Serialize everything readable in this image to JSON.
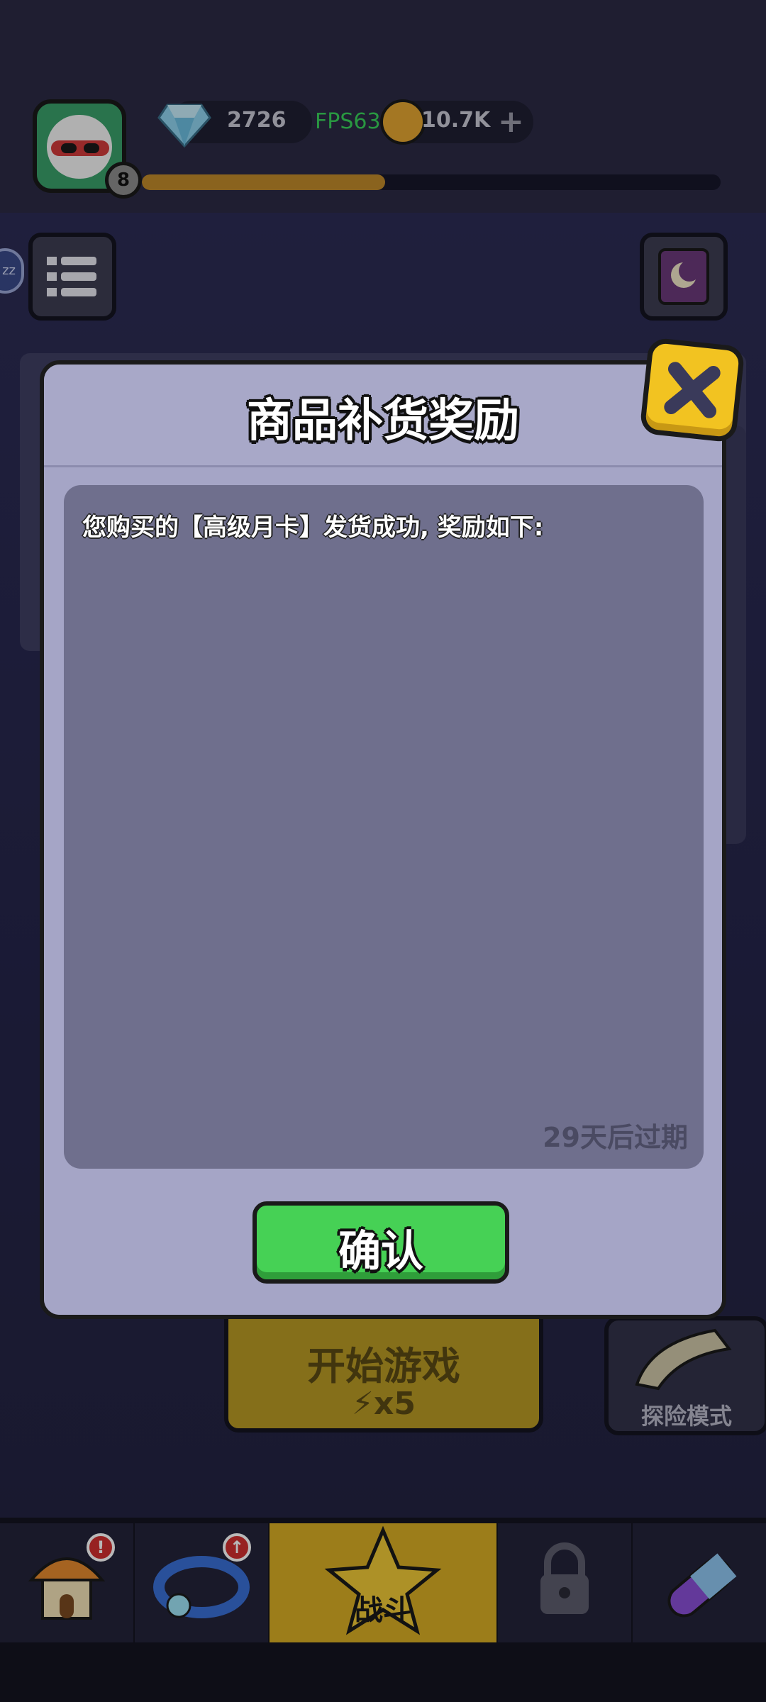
{
  "hud": {
    "gems": "2726",
    "fps": "FPS63",
    "coins": "10.7K",
    "player_level": "8",
    "xp_progress": 0.42
  },
  "side": {
    "sleep_label": "zz"
  },
  "main": {
    "start_label": "开始游戏",
    "start_cost": "x5",
    "adventure_label": "探险模式"
  },
  "nav": {
    "battle_label": "战斗",
    "shop_badge": "!",
    "equip_badge": "↑"
  },
  "dialog": {
    "title": "商品补货奖励",
    "message": "您购买的【高级月卡】发货成功, 奖励如下:",
    "expiry": "29天后过期",
    "confirm_label": "确认"
  },
  "colors": {
    "accent_green": "#46d155",
    "accent_yellow": "#f2c321",
    "fps_green": "#39d15b"
  }
}
